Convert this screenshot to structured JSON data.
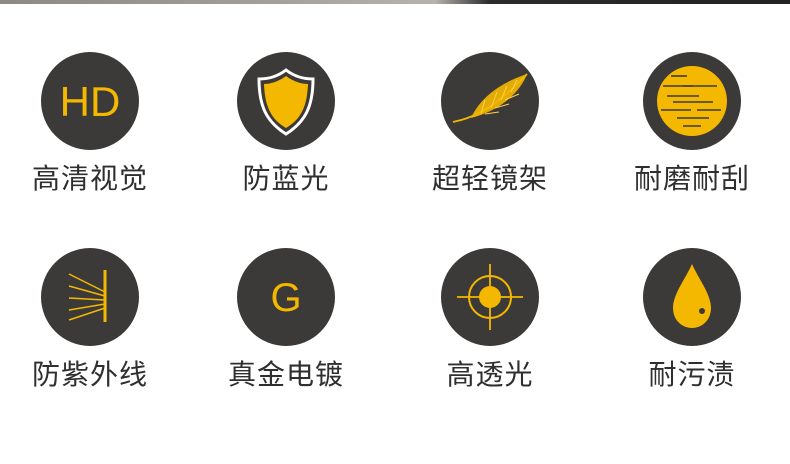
{
  "accent_color": "#f5b800",
  "circle_color": "#3c3a38",
  "features": [
    {
      "icon": "hd-icon",
      "icon_text": "HD",
      "label": "高清视觉"
    },
    {
      "icon": "shield-icon",
      "label": "防蓝光"
    },
    {
      "icon": "feather-icon",
      "label": "超轻镜架"
    },
    {
      "icon": "scratch-disc-icon",
      "label": "耐磨耐刮"
    },
    {
      "icon": "uv-rays-icon",
      "label": "防紫外线"
    },
    {
      "icon": "g-letter-icon",
      "icon_text": "G",
      "label": "真金电镀"
    },
    {
      "icon": "crosshair-icon",
      "label": "高透光"
    },
    {
      "icon": "droplet-icon",
      "label": "耐污渍"
    }
  ]
}
